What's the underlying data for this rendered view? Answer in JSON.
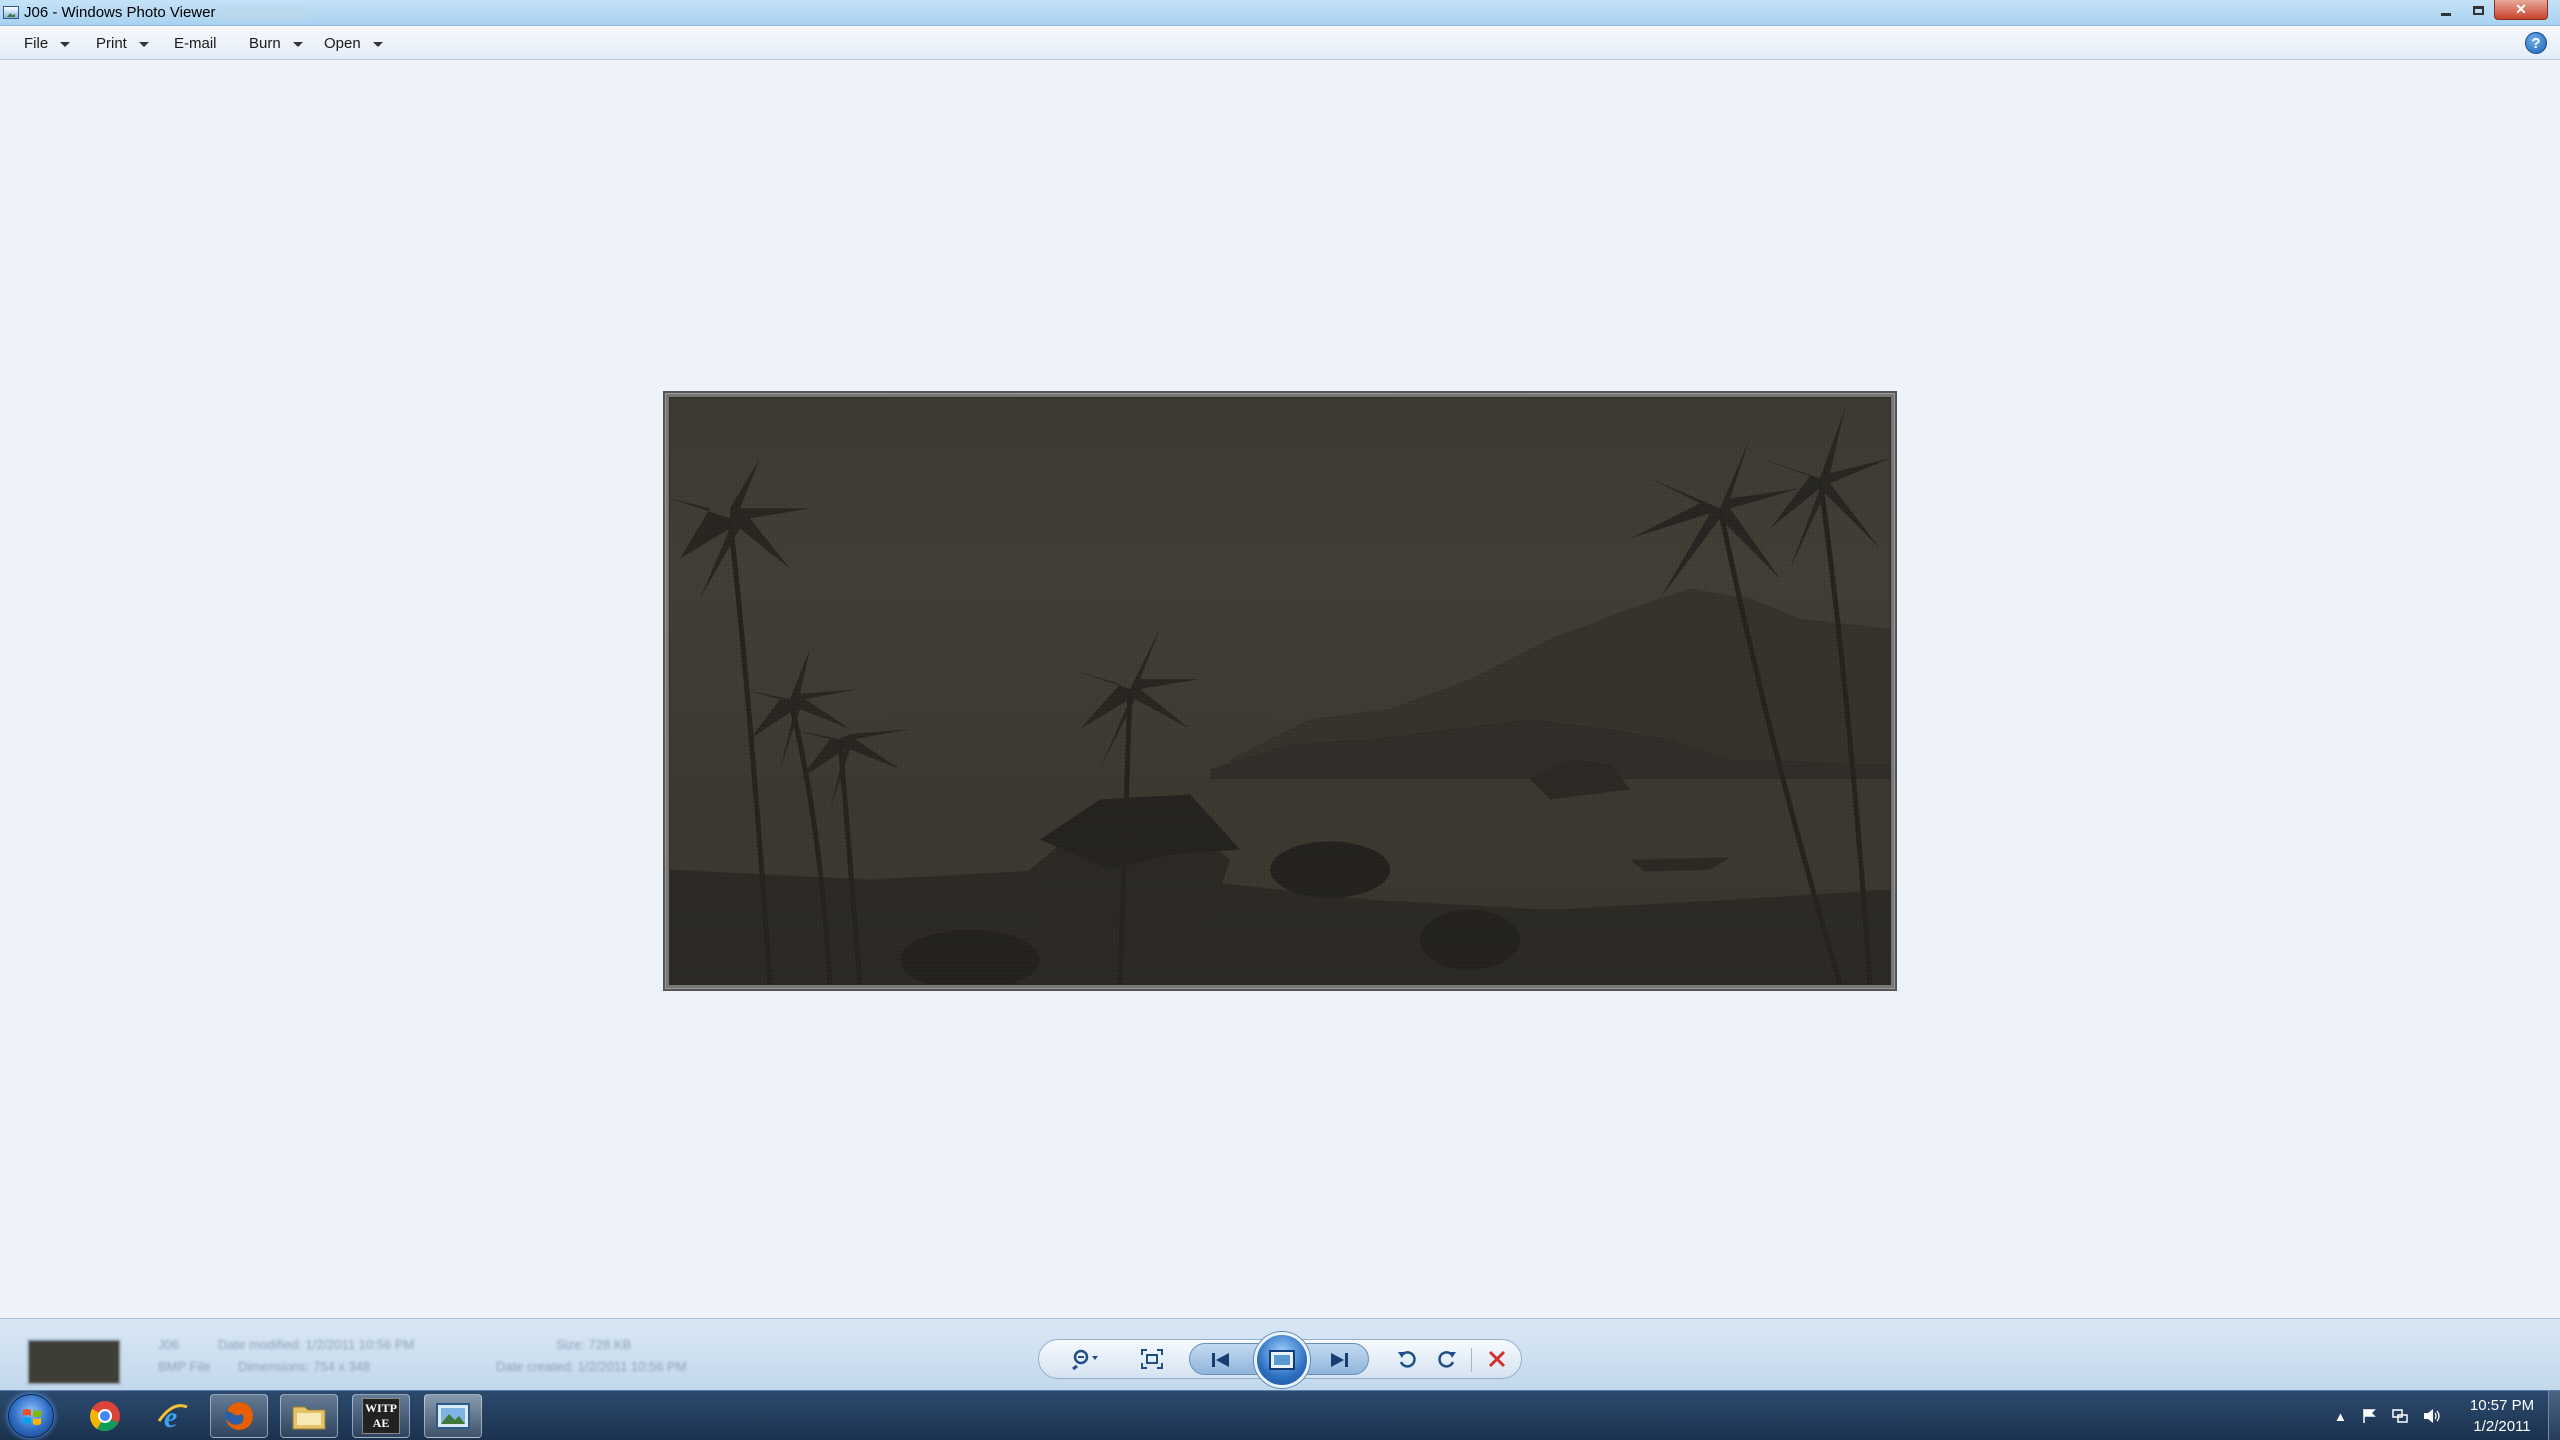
{
  "window": {
    "title": "J06 - Windows Photo Viewer",
    "controls": {
      "minimize": "minimize",
      "maximize": "maximize",
      "close": "✕"
    }
  },
  "menu": {
    "items": [
      {
        "label": "File",
        "has_dropdown": true
      },
      {
        "label": "Print",
        "has_dropdown": true
      },
      {
        "label": "E-mail",
        "has_dropdown": false
      },
      {
        "label": "Burn",
        "has_dropdown": true
      },
      {
        "label": "Open",
        "has_dropdown": true
      }
    ],
    "help_label": "?"
  },
  "info_panel": {
    "name": "J06",
    "type": "BMP File",
    "date_modified": "Date modified: 1/2/2011 10:56 PM",
    "dimensions": "Dimensions: 754 x 348",
    "size": "Size: 728 KB",
    "date_created": "Date created: 1/2/2011 10:56 PM"
  },
  "controls": {
    "zoom": "zoom-icon",
    "actual_size": "actual-size-icon",
    "previous": "previous-icon",
    "slideshow": "slideshow-icon",
    "next": "next-icon",
    "rotate_ccw": "rotate-counterclockwise-icon",
    "rotate_cw": "rotate-clockwise-icon",
    "delete": "delete-icon"
  },
  "taskbar": {
    "apps": [
      "chrome-icon",
      "internet-explorer-icon",
      "firefox-icon",
      "explorer-icon",
      "witp-ae-icon",
      "photo-viewer-icon"
    ],
    "witp_label": "WITP AE",
    "time": "10:57 PM",
    "date": "1/2/2011"
  },
  "colors": {
    "accent": "#2d6fc0",
    "delete": "#d0312d"
  }
}
